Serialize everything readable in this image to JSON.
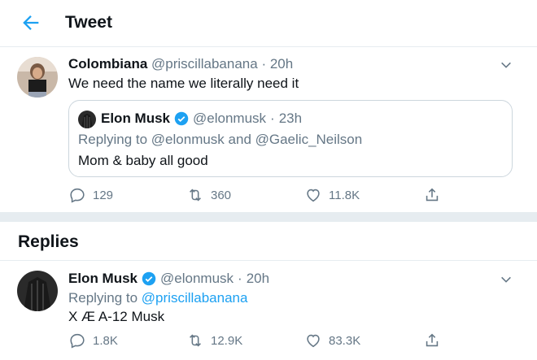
{
  "header": {
    "title": "Tweet"
  },
  "tweet": {
    "name": "Colombiana",
    "handle": "@priscillabanana",
    "time": "20h",
    "text": "We need the name we literally need it",
    "quote": {
      "name": "Elon Musk",
      "handle": "@elonmusk",
      "time": "23h",
      "replying_prefix": "Replying to",
      "replying_users": "@elonmusk and @Gaelic_Neilson",
      "text": "Mom & baby all good"
    },
    "actions": {
      "replies": "129",
      "retweets": "360",
      "likes": "11.8K"
    }
  },
  "replies_section": {
    "title": "Replies"
  },
  "reply": {
    "name": "Elon Musk",
    "handle": "@elonmusk",
    "time": "20h",
    "replying_prefix": "Replying to",
    "replying_user": "@priscillabanana",
    "text": "X Æ A-12 Musk",
    "actions": {
      "replies": "1.8K",
      "retweets": "12.9K",
      "likes": "83.3K"
    }
  },
  "colors": {
    "accent": "#1da1f2",
    "muted": "#657786",
    "divider": "#e6ecf0"
  },
  "icons": [
    "back-arrow-icon",
    "chevron-down-icon",
    "verified-badge-icon",
    "reply-icon",
    "retweet-icon",
    "like-icon",
    "share-icon"
  ]
}
